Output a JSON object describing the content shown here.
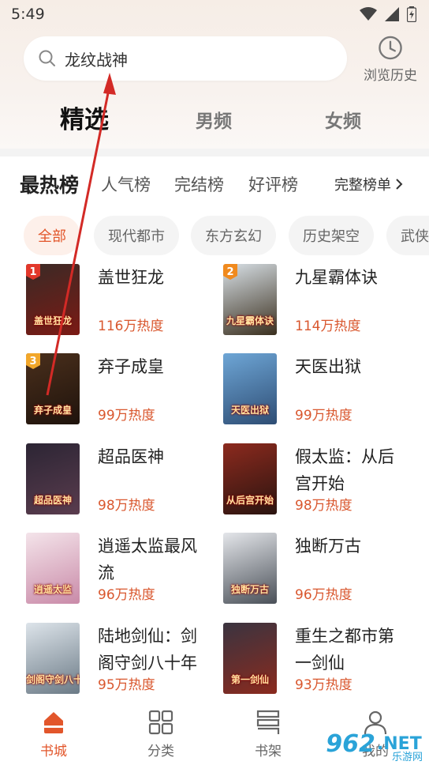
{
  "status": {
    "time": "5:49"
  },
  "search": {
    "value": "龙纹战神",
    "icon": "search-icon"
  },
  "history": {
    "label": "浏览历史",
    "icon": "clock-icon"
  },
  "channels": [
    {
      "label": "精选"
    },
    {
      "label": "男频"
    },
    {
      "label": "女频"
    }
  ],
  "ranking": {
    "title": "最热榜",
    "tabs": [
      "人气榜",
      "完结榜",
      "好评榜"
    ],
    "full_label": "完整榜单",
    "full_icon": "chevron-right-icon"
  },
  "chips": [
    {
      "label": "全部"
    },
    {
      "label": "现代都市"
    },
    {
      "label": "东方玄幻"
    },
    {
      "label": "历史架空"
    },
    {
      "label": "武侠"
    }
  ],
  "books": [
    {
      "title": "盖世狂龙",
      "heat": "116万热度",
      "rank": "1",
      "cover_text": "盖世狂龙",
      "colors": [
        "#3a2a26",
        "#7b1a14"
      ]
    },
    {
      "title": "九星霸体诀",
      "heat": "114万热度",
      "rank": "2",
      "cover_text": "九星霸体诀",
      "colors": [
        "#d8e0e6",
        "#3a2f1e"
      ]
    },
    {
      "title": "弃子成皇",
      "heat": "99万热度",
      "rank": "3",
      "cover_text": "弃子成皇",
      "colors": [
        "#4a2f1c",
        "#1f130c"
      ]
    },
    {
      "title": "天医出狱",
      "heat": "99万热度",
      "rank": "",
      "cover_text": "天医出狱",
      "colors": [
        "#6ea6d6",
        "#2e4d74"
      ]
    },
    {
      "title": "超品医神",
      "heat": "98万热度",
      "rank": "",
      "cover_text": "超品医神",
      "colors": [
        "#2c2534",
        "#5a3c4e"
      ]
    },
    {
      "title": "假太监：从后宫开始",
      "heat": "98万热度",
      "rank": "",
      "cover_text": "从后宫开始",
      "colors": [
        "#8c2a1e",
        "#2a1410"
      ]
    },
    {
      "title": "逍遥太监最风流",
      "heat": "96万热度",
      "rank": "",
      "cover_text": "逍遥太监",
      "colors": [
        "#f4e4ea",
        "#c98aa8"
      ]
    },
    {
      "title": "独断万古",
      "heat": "96万热度",
      "rank": "",
      "cover_text": "独断万古",
      "colors": [
        "#e4e6ea",
        "#4a5058"
      ]
    },
    {
      "title": "陆地剑仙：剑阁守剑八十年",
      "heat": "95万热度",
      "rank": "",
      "cover_text": "剑阁守剑八十年",
      "colors": [
        "#dde4ea",
        "#6b7a86"
      ]
    },
    {
      "title": "重生之都市第一剑仙",
      "heat": "93万热度",
      "rank": "",
      "cover_text": "第一剑仙",
      "colors": [
        "#3a3440",
        "#8a2a1e"
      ]
    }
  ],
  "bottom_nav": [
    {
      "label": "书城",
      "icon": "home-icon"
    },
    {
      "label": "分类",
      "icon": "grid-icon"
    },
    {
      "label": "书架",
      "icon": "bookshelf-icon"
    },
    {
      "label": "我的",
      "icon": "user-icon"
    }
  ],
  "watermark": {
    "big": "962",
    "net": ".NET",
    "small": "乐游网"
  },
  "colors": {
    "accent": "#e2562b",
    "heat": "#d9572e",
    "arrow": "#d32a26"
  }
}
